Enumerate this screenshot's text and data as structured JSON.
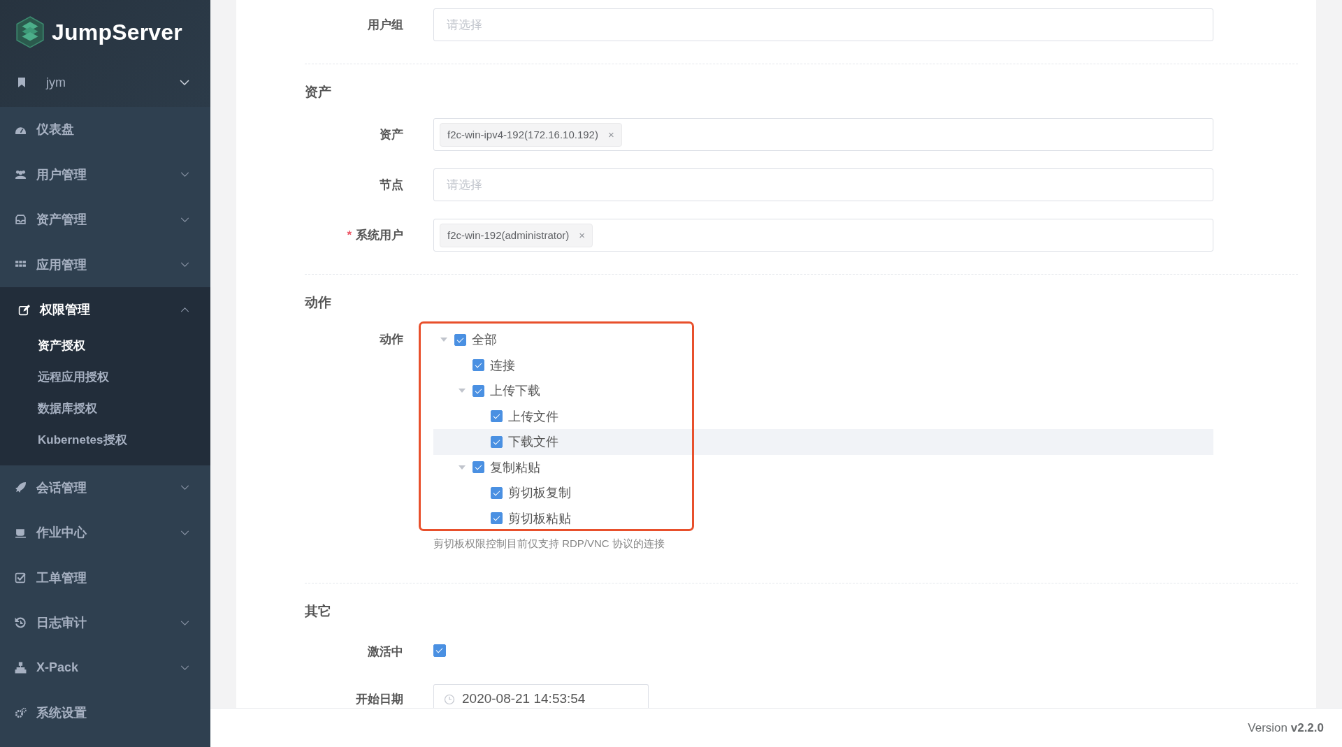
{
  "sidebar": {
    "logo": "JumpServer",
    "org": {
      "name": "jym"
    },
    "items": [
      {
        "label": "仪表盘",
        "kind": "link"
      },
      {
        "label": "用户管理",
        "kind": "submenu",
        "expanded": false
      },
      {
        "label": "资产管理",
        "kind": "submenu",
        "expanded": false
      },
      {
        "label": "应用管理",
        "kind": "submenu",
        "expanded": false
      },
      {
        "label": "权限管理",
        "kind": "submenu",
        "expanded": true,
        "children": [
          {
            "label": "资产授权",
            "selected": true
          },
          {
            "label": "远程应用授权",
            "selected": false
          },
          {
            "label": "数据库授权",
            "selected": false
          },
          {
            "label": "Kubernetes授权",
            "selected": false
          }
        ]
      },
      {
        "label": "会话管理",
        "kind": "submenu",
        "expanded": false
      },
      {
        "label": "作业中心",
        "kind": "submenu",
        "expanded": false
      },
      {
        "label": "工单管理",
        "kind": "link"
      },
      {
        "label": "日志审计",
        "kind": "submenu",
        "expanded": false
      },
      {
        "label": "X-Pack",
        "kind": "submenu",
        "expanded": false
      },
      {
        "label": "系统设置",
        "kind": "link"
      }
    ]
  },
  "form": {
    "required_mark": "*",
    "sections": [
      {
        "rows": [
          {
            "label": "用户组",
            "kind": "select",
            "required": false,
            "placeholder": "请选择"
          }
        ]
      },
      {
        "title": "资产",
        "rows": [
          {
            "label": "资产",
            "kind": "select",
            "required": false,
            "tags": [
              "f2c-win-ipv4-192(172.16.10.192)"
            ],
            "tag_close": "×"
          },
          {
            "label": "节点",
            "kind": "select",
            "required": false,
            "placeholder": "请选择"
          },
          {
            "label": "系统用户",
            "kind": "select",
            "required": true,
            "tags": [
              "f2c-win-192(administrator)"
            ],
            "tag_close": "×"
          }
        ]
      },
      {
        "title": "动作",
        "rows": [
          {
            "label": "动作",
            "kind": "tree",
            "required": false,
            "help": "剪切板权限控制目前仅支持 RDP/VNC 协议的连接",
            "nodes": [
              {
                "label": "全部",
                "checked": true,
                "expanded": true,
                "highlighted": false,
                "children": [
                  {
                    "label": "连接",
                    "checked": true,
                    "highlighted": false
                  },
                  {
                    "label": "上传下载",
                    "checked": true,
                    "expanded": true,
                    "highlighted": false,
                    "children": [
                      {
                        "label": "上传文件",
                        "checked": true,
                        "highlighted": false
                      },
                      {
                        "label": "下载文件",
                        "checked": true,
                        "highlighted": true
                      }
                    ]
                  },
                  {
                    "label": "复制粘贴",
                    "checked": true,
                    "expanded": true,
                    "highlighted": false,
                    "children": [
                      {
                        "label": "剪切板复制",
                        "checked": true,
                        "highlighted": false
                      },
                      {
                        "label": "剪切板粘贴",
                        "checked": true,
                        "highlighted": false
                      }
                    ]
                  }
                ]
              }
            ]
          }
        ]
      },
      {
        "title": "其它",
        "rows": [
          {
            "label": "激活中",
            "kind": "checkbox",
            "required": false,
            "checked": true
          },
          {
            "label": "开始日期",
            "kind": "date",
            "required": false,
            "value": "2020-08-21 14:53:54"
          }
        ]
      }
    ]
  },
  "footer": {
    "version": "Version **v2.2.0**"
  }
}
